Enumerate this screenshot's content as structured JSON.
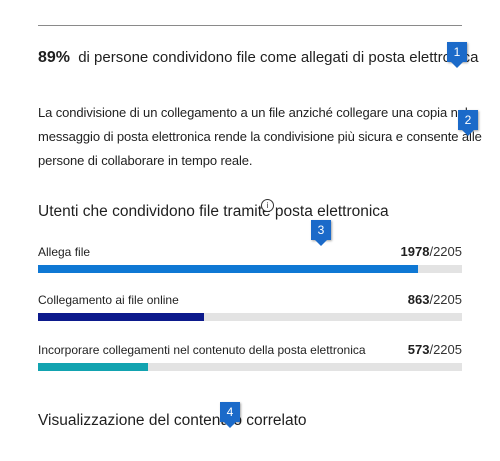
{
  "stat": {
    "percent": "89%",
    "text": "di persone condividono file come allegati di posta elettronica"
  },
  "description": {
    "line1": "La condivisione di un collegamento a un file anziché collegare una copia nel",
    "line2": "messaggio di posta elettronica rende la condivisione più sicura e consente alle",
    "line3": "persone di collaborare in tempo reale."
  },
  "section_title": "Utenti che condividono file tramite posta elettronica",
  "bars": [
    {
      "label": "Allega file",
      "value": "1978",
      "total": "/2205",
      "fraction": 0.897,
      "color": "#0f78d4"
    },
    {
      "label": "Collegamento ai file online",
      "value": "863",
      "total": "/2205",
      "fraction": 0.391,
      "color": "#0c1a8c"
    },
    {
      "label": "Incorporare collegamenti nel contenuto della posta elettronica",
      "value": "573",
      "total": "/2205",
      "fraction": 0.26,
      "color": "#12a3b0"
    }
  ],
  "related_title": "Visualizzazione del contenuto correlato",
  "callouts": {
    "c1": "1",
    "c2": "2",
    "c3": "3",
    "c4": "4"
  },
  "info_icon": "info-icon",
  "colors": {
    "callout": "#1b6ac9",
    "track": "#e3e3e3"
  }
}
